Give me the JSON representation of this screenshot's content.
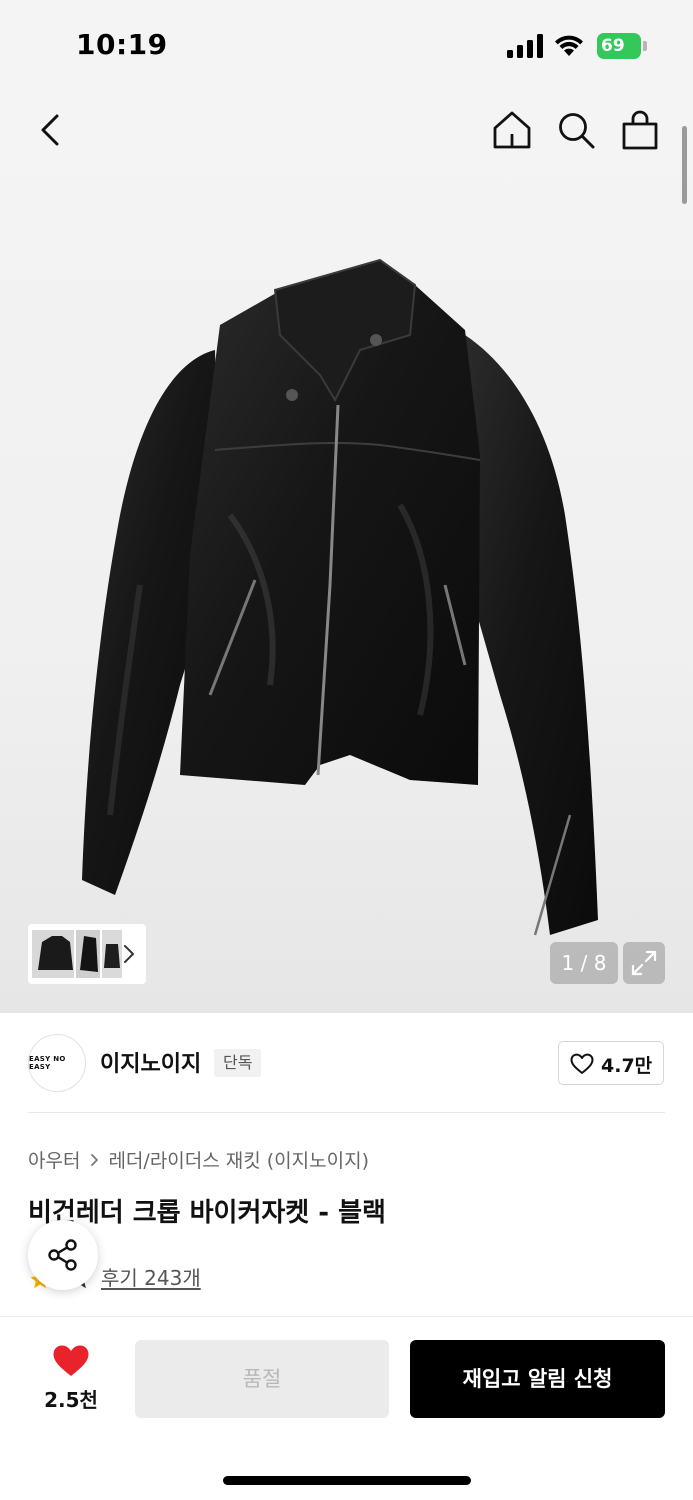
{
  "status_bar": {
    "time": "10:19",
    "battery": "69",
    "icons": [
      "signal-icon",
      "wifi-icon",
      "battery-icon"
    ]
  },
  "nav": {
    "icons": [
      "back-chevron-icon",
      "home-icon",
      "search-icon",
      "shopping-bag-icon"
    ]
  },
  "gallery": {
    "counter": "1 / 8",
    "icons": [
      "chevron-right-icon",
      "expand-icon"
    ]
  },
  "brand": {
    "logo_text": "EASY NO EASY",
    "name": "이지노이지",
    "badge": "단독",
    "likes": "4.7만"
  },
  "product": {
    "category_main": "아우터",
    "category_sub": "레더/라이더스 재킷 (이지노이지)",
    "title": "비건레더 크롭 바이커자켓 - 블랙",
    "reviews": "후기 243개"
  },
  "bottom_bar": {
    "wish_count": "2.5천",
    "soldout_label": "품절",
    "restock_label": "재입고 알림 신청"
  },
  "colors": {
    "accent_red": "#e8232c",
    "primary_black": "#000000",
    "battery_green": "#34c759",
    "disabled_gray": "#ebebeb"
  }
}
